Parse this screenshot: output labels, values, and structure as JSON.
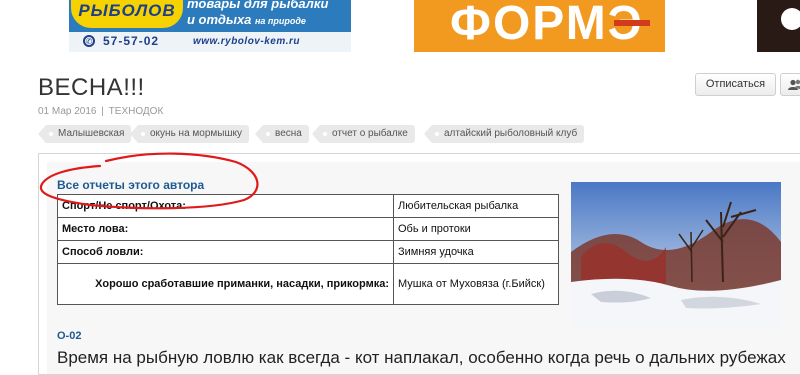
{
  "banners": {
    "fishing": {
      "logo": "РЫБОЛОВ",
      "slogan_line1": "товары для рыбалки",
      "slogan_line2": "и отдыха",
      "slogan_small": "на природе",
      "phone": "57-57-02",
      "site": "www.rybolov-kem.ru"
    },
    "forme": {
      "word": "ФОРМЭ"
    }
  },
  "article": {
    "title": "ВЕСНА!!!",
    "date": "01 Мар 2016",
    "separator": "|",
    "author": "ТЕХНОДОК"
  },
  "actions": {
    "unsubscribe_label": "Отписаться"
  },
  "tags": [
    "Малышевская",
    "окунь на мормышку",
    "весна",
    "отчет о рыбалке",
    "алтайский рыболовный клуб"
  ],
  "report": {
    "author_reports_link": "Все отчеты этого автора",
    "rows": [
      {
        "key": "Спорт/Не спорт/Охота:",
        "value": "Любительская рыбалка"
      },
      {
        "key": "Место лова:",
        "value": "Обь и протоки"
      },
      {
        "key": "Способ ловли:",
        "value": "Зимняя удочка"
      },
      {
        "key": "Хорошо сработавшие приманки, насадки, прикормка:",
        "value": "Мушка от Муховяза (г.Бийск)"
      }
    ],
    "code": "О-02",
    "body_start": "Время на рыбную ловлю как всегда - кот наплакал, особенно когда речь о дальних рубежах"
  },
  "colors": {
    "link": "#1e5a92",
    "annotation": "#e01a1a",
    "fishing_ad_blue": "#2c7bbd",
    "fishing_ad_yellow": "#f5d200",
    "forme_orange": "#f29a1f",
    "tag_bg": "#e9e9e9"
  }
}
